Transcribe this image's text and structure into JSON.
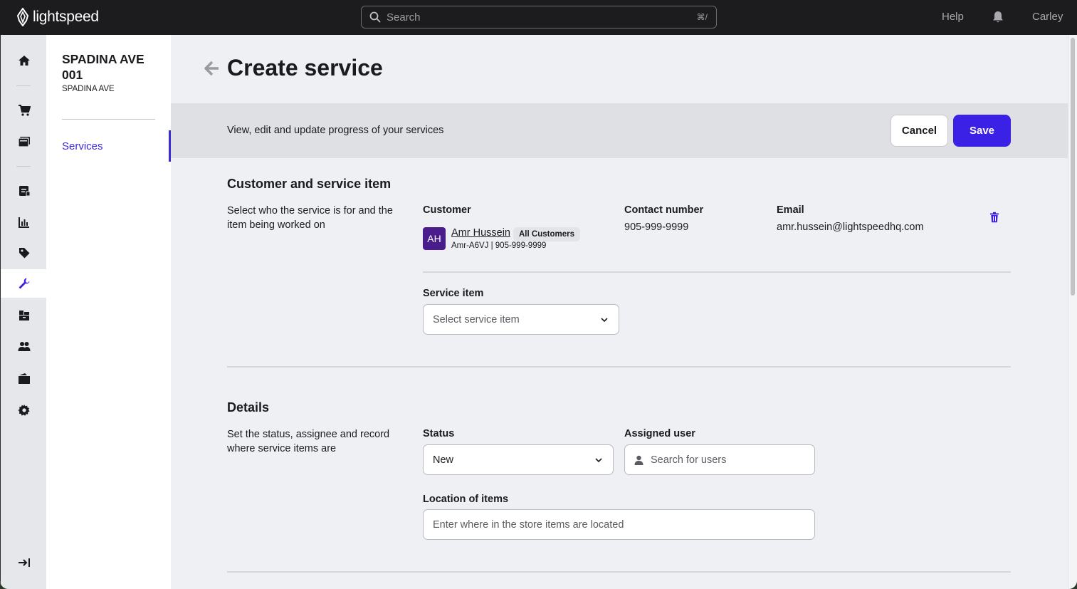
{
  "brand": {
    "name": "lightspeed"
  },
  "topbar": {
    "search_placeholder": "Search",
    "search_shortcut": "⌘/",
    "help": "Help",
    "user": "Carley"
  },
  "rail": {
    "items": [
      "home-icon",
      "cart-icon",
      "register-icon",
      "invoice-icon",
      "reports-icon",
      "tag-icon",
      "wrench-icon",
      "inventory-icon",
      "customers-icon",
      "folder-icon",
      "settings-icon",
      "collapse-icon"
    ],
    "active": "wrench-icon"
  },
  "store": {
    "name": "SPADINA AVE 001",
    "sub": "SPADINA AVE"
  },
  "subnav": {
    "active_label": "Services"
  },
  "page": {
    "title": "Create service",
    "banner_text": "View, edit and update progress of your services",
    "cancel": "Cancel",
    "save": "Save"
  },
  "section1": {
    "title": "Customer and service item",
    "desc": "Select who the service is for and the item being worked on",
    "customer_label": "Customer",
    "customer_initials": "AH",
    "customer_name": "Amr Hussein",
    "customer_tag": "All Customers",
    "customer_sub": "Amr-A6VJ | 905-999-9999",
    "contact_label": "Contact number",
    "contact_value": "905-999-9999",
    "email_label": "Email",
    "email_value": "amr.hussein@lightspeedhq.com",
    "service_item_label": "Service item",
    "service_item_placeholder": "Select service item"
  },
  "section2": {
    "title": "Details",
    "desc": "Set the status, assignee and record where service items are",
    "status_label": "Status",
    "status_value": "New",
    "assigned_label": "Assigned user",
    "assigned_placeholder": "Search for users",
    "location_label": "Location of items",
    "location_placeholder": "Enter where in the store items are located"
  },
  "colors": {
    "accent": "#3b20e6",
    "topbar": "#1c1c1e",
    "avatar": "#4a1d8c"
  }
}
